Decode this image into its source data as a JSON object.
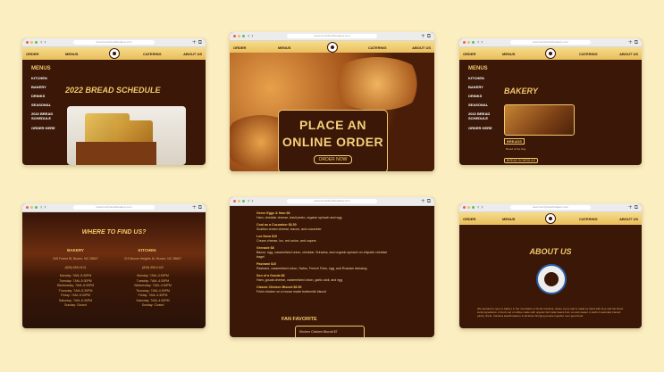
{
  "browser": {
    "url": "www.hourlyheartbreakery.com"
  },
  "nav": {
    "order": "ORDER",
    "menus": "MENUS",
    "catering": "CATERING",
    "about": "ABOUT US"
  },
  "w1": {
    "title": "2022 BREAD SCHEDULE",
    "side": [
      "MENUS",
      "KITCHEN",
      "BAKERY",
      "DRINKS",
      "SEASONAL",
      "2022 BREAD SCHEDULE",
      "ORDER HERE"
    ]
  },
  "w2": {
    "headline_1": "PLACE AN",
    "headline_2": "ONLINE ORDER",
    "button": "ORDER NOW"
  },
  "w3": {
    "title": "BAKERY",
    "side": [
      "MENUS",
      "KITCHEN",
      "BAKERY",
      "DRINKS",
      "SEASONAL",
      "2022 BREAD SCHEDULE",
      "ORDER HERE"
    ],
    "tag": "BREADS",
    "text": "Bread of the Day",
    "button": "BREAD SCHEDULE"
  },
  "w4": {
    "title": "WHERE TO FIND US?",
    "col1_head": "BAKERY",
    "col2_head": "KITCHEN",
    "col1": [
      "245 Forest St, Boone, NC 28607",
      "(828) 555-0101",
      "Monday: 7AM–5:30PM",
      "Tuesday: 7AM–5:30PM",
      "Wednesday: 7AM–5:30PM",
      "Thursday: 7AM–5:30PM",
      "Friday: 7AM–5:30PM",
      "Saturday: 7AM–5:30PM",
      "Sunday: Closed"
    ],
    "col2": [
      "213 Boone Heights Dr, Boone, NC 28607",
      "(828) 555-0102",
      "Monday: 7AM–4:30PM",
      "Tuesday: 7AM–4:30PM",
      "Wednesday: 7AM–4:30PM",
      "Thursday: 7AM–4:30PM",
      "Friday: 7AM–4:30PM",
      "Saturday: 7AM–4:30PM",
      "Sunday: Closed"
    ]
  },
  "w5": {
    "items": [
      {
        "name": "Green Eggs & Ham $8",
        "desc": "Ham, cheddar cheese, basil pesto, organic spinach and egg"
      },
      {
        "name": "Cool as a Cucumber $6.50",
        "desc": "Scallion cream cheese, bacon, and cucumber"
      },
      {
        "name": "Lox Nova $10",
        "desc": "Cream cheese, lox, red onion, and capers"
      },
      {
        "name": "Grenade $8",
        "desc": "Bacon, egg, caramelized onion, cheddar, Sriracha, and organic spinach on chipotle cheddar bagel"
      },
      {
        "name": "Pastrami $10",
        "desc": "Pastrami, caramelized onion, Swiss, French Fries, egg, and Russian dressing"
      },
      {
        "name": "Son of a Gouda $8",
        "desc": "Ham, gouda cheese, caramelized onion, garlic aioli, and egg"
      },
      {
        "name": "Classic Chicken Biscuit $6.50",
        "desc": "Fried chicken on a house made buttermilk biscuit"
      }
    ],
    "fav_head": "FAN FAVORITE",
    "fav_item": "Kitchen Chicken Biscuit $7"
  },
  "w6": {
    "title": "ABOUT US",
    "text": "We decided to open a bakery in the mountains of North Carolina, where every loaf is made by hand with love and the finest local ingredients. A fresh cup of coffee made with organic fair trade beans from a local roaster. A staff of nationally trained pastry chefs. Carolina Heartbreakery is all about bringing people together over good food."
  },
  "colors": {
    "brown": "#3a1707",
    "gold": "#f3c86b",
    "nav": "#e9bd5a"
  }
}
